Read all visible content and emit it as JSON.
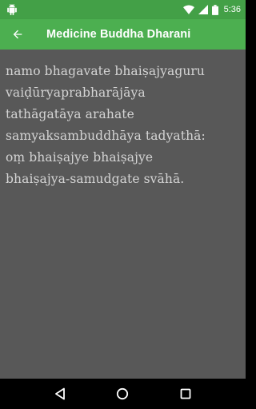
{
  "status_bar": {
    "time": "5:36",
    "notification_icon": "android-icon",
    "icons": [
      "wifi-icon",
      "signal-icon",
      "battery-icon"
    ]
  },
  "app_bar": {
    "title": "Medicine Buddha Dharani",
    "back_icon": "arrow-back-icon"
  },
  "content": {
    "lines": [
      "namo bhagavate bhaiṣajyaguru",
      "vaiḍūryaprabharājāya",
      "tathāgatāya arahate",
      "samyaksambuddhāya tadyathā:",
      "oṃ bhaiṣajye bhaiṣajye",
      "bhaiṣajya-samudgate svāhā."
    ]
  },
  "nav_bar": {
    "buttons": [
      "back-triangle-icon",
      "home-circle-icon",
      "recents-square-icon"
    ]
  },
  "colors": {
    "status_bar": "#43a047",
    "app_bar": "#4caf50",
    "background": "#585858",
    "text": "#d4d4d4"
  }
}
